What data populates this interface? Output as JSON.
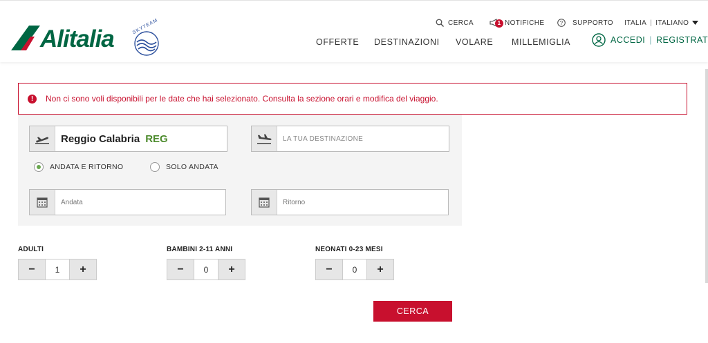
{
  "header": {
    "logo_text": "Alitalia",
    "skyteam_text": "SKYTEAM",
    "utility": {
      "search": "CERCA",
      "notifications": "NOTIFICHE",
      "notifications_count": "1",
      "support": "SUPPORTO",
      "country": "ITALIA",
      "separator": "|",
      "language": "ITALIANO"
    },
    "nav": [
      "OFFERTE",
      "DESTINAZIONI",
      "VOLARE",
      "MILLEMIGLIA"
    ],
    "login": {
      "accedi": "ACCEDI",
      "sep": "|",
      "registrati": "REGISTRATI"
    }
  },
  "error": {
    "icon_text": "!",
    "message": "Non ci sono voli disponibili per le date che hai selezionato. Consulta la sezione orari e modifica del viaggio."
  },
  "search": {
    "origin_name": "Reggio Calabria",
    "origin_code": "REG",
    "destination_placeholder": "LA TUA DESTINAZIONE",
    "trip_types": [
      {
        "label": "ANDATA E RITORNO",
        "selected": true
      },
      {
        "label": "SOLO ANDATA",
        "selected": false
      }
    ],
    "departure_placeholder": "Andata",
    "return_placeholder": "Ritorno"
  },
  "passengers": [
    {
      "label": "ADULTI",
      "minus": "−",
      "value": "1",
      "plus": "+"
    },
    {
      "label": "BAMBINI 2-11 ANNI",
      "minus": "−",
      "value": "0",
      "plus": "+"
    },
    {
      "label": "NEONATI 0-23 MESI",
      "minus": "−",
      "value": "0",
      "plus": "+"
    }
  ],
  "submit_label": "CERCA",
  "colors": {
    "brand_green": "#006643",
    "alert_red": "#c8102e",
    "code_green": "#4d8b2d"
  }
}
